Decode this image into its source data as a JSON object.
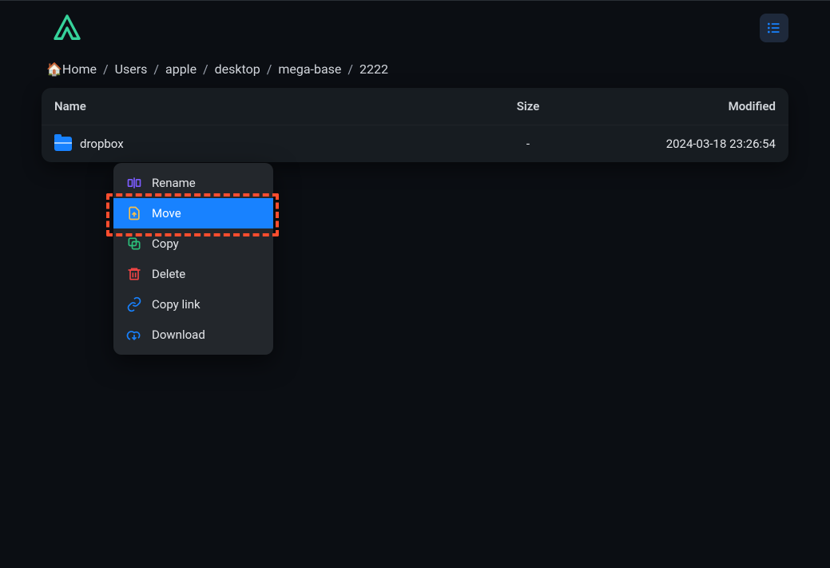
{
  "breadcrumb": {
    "home_icon": "🏠",
    "items": [
      "Home",
      "Users",
      "apple",
      "desktop",
      "mega-base",
      "2222"
    ]
  },
  "table": {
    "headers": {
      "name": "Name",
      "size": "Size",
      "modified": "Modified"
    },
    "rows": [
      {
        "name": "dropbox",
        "size": "-",
        "modified": "2024-03-18 23:26:54"
      }
    ]
  },
  "context_menu": {
    "items": [
      {
        "label": "Rename",
        "icon": "rename"
      },
      {
        "label": "Move",
        "icon": "move",
        "hovered": true
      },
      {
        "label": "Copy",
        "icon": "copy"
      },
      {
        "label": "Delete",
        "icon": "delete"
      },
      {
        "label": "Copy link",
        "icon": "link"
      },
      {
        "label": "Download",
        "icon": "download"
      }
    ]
  },
  "icon_colors": {
    "rename": "#7c5cff",
    "move": "#f6c04d",
    "copy": "#2bbf7a",
    "delete": "#ef4444",
    "link": "#1882ff",
    "download": "#1882ff",
    "list_toggle": "#1882ff"
  }
}
